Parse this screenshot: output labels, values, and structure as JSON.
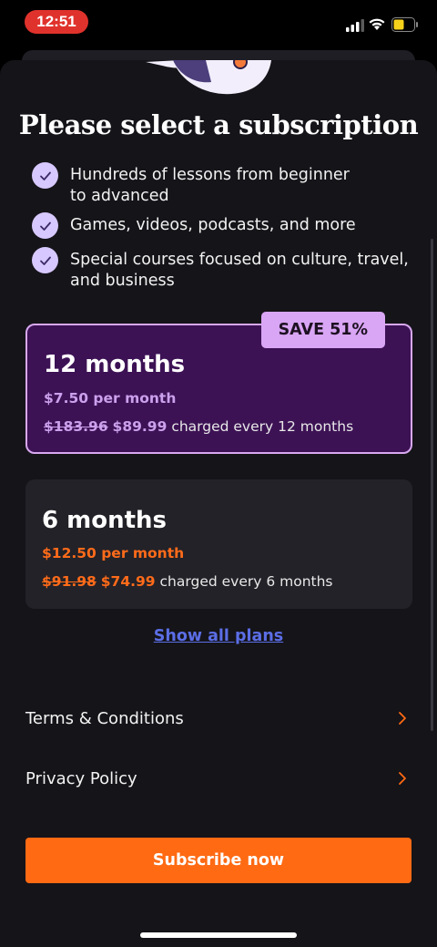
{
  "status": {
    "time": "12:51"
  },
  "sheet": {
    "title": "Please select a subscription",
    "benefits": [
      {
        "line1": "Hundreds of lessons from beginner",
        "line2": "to advanced"
      },
      {
        "line1": "Games, videos, podcasts, and more",
        "line2": ""
      },
      {
        "line1": "Special courses focused on culture, travel,",
        "line2": "and business"
      }
    ],
    "plans": [
      {
        "badge": "SAVE 51%",
        "name": "12 months",
        "per_month": "$7.50 per month",
        "old_price": "$183.96",
        "new_price": "$89.99",
        "charge_text": "charged every 12 months",
        "selected": true
      },
      {
        "name": "6 months",
        "per_month": "$12.50 per month",
        "old_price": "$91.98",
        "new_price": "$74.99",
        "charge_text": "charged every 6 months",
        "selected": false
      }
    ],
    "show_all_plans": "Show all plans",
    "links": [
      {
        "label": "Terms & Conditions"
      },
      {
        "label": "Privacy Policy"
      }
    ],
    "subscribe_label": "Subscribe now"
  },
  "colors": {
    "accent_orange": "#ff6a13",
    "selected_plan_bg": "#3d1255",
    "badge_bg": "#d9a5f5",
    "link_blue": "#5b6ee6"
  }
}
